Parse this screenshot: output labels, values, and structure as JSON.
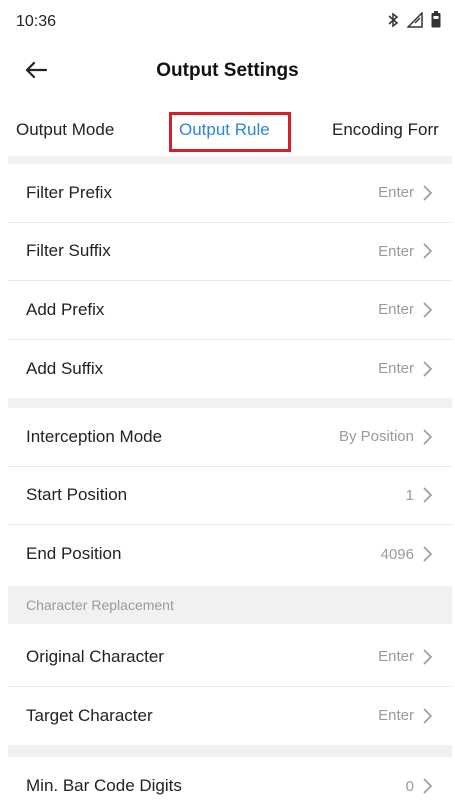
{
  "status_bar": {
    "time": "10:36",
    "icons": [
      "bluetooth-icon",
      "signal-icon",
      "battery-icon"
    ]
  },
  "header": {
    "title": "Output Settings",
    "back_icon": "back-arrow-icon"
  },
  "tabs": [
    {
      "label": "Output Mode",
      "selected": false
    },
    {
      "label": "Output Rule",
      "selected": true
    },
    {
      "label": "Encoding Forr",
      "selected": false
    }
  ],
  "accent_color": "#2a87d6",
  "highlight_color": "#d81d2a",
  "group1": [
    {
      "label": "Filter Prefix",
      "value": "Enter"
    },
    {
      "label": "Filter Suffix",
      "value": "Enter"
    },
    {
      "label": "Add Prefix",
      "value": "Enter"
    },
    {
      "label": "Add Suffix",
      "value": "Enter"
    }
  ],
  "group2": [
    {
      "label": "Interception Mode",
      "value": "By Position"
    },
    {
      "label": "Start Position",
      "value": "1"
    },
    {
      "label": "End Position",
      "value": "4096"
    }
  ],
  "section_character_replacement": "Character Replacement",
  "group3": [
    {
      "label": "Original Character",
      "value": "Enter"
    },
    {
      "label": "Target Character",
      "value": "Enter"
    }
  ],
  "group4": [
    {
      "label": "Min. Bar Code Digits",
      "value": "0"
    }
  ]
}
